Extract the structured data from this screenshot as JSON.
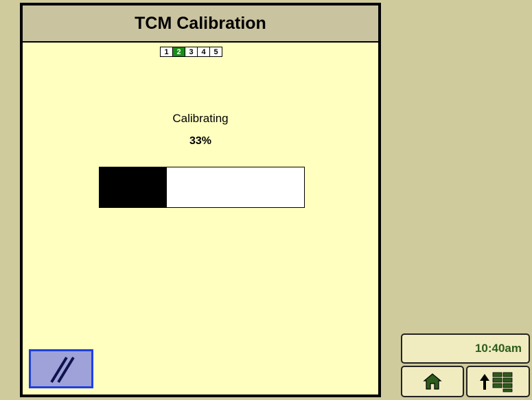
{
  "screen": {
    "title": "TCM Calibration"
  },
  "steps": [
    {
      "label": "1",
      "active": false
    },
    {
      "label": "2",
      "active": true
    },
    {
      "label": "3",
      "active": false
    },
    {
      "label": "4",
      "active": false
    },
    {
      "label": "5",
      "active": false
    }
  ],
  "calibration": {
    "status_label": "Calibrating",
    "percent_text": "33%",
    "progress_fraction": 0.33
  },
  "shortcut": {
    "icon": "slash-lines-icon"
  },
  "clock": {
    "time": "10:40am"
  },
  "nav": {
    "home_icon": "home-icon",
    "menu_icon": "menu-up-arrow-icon"
  },
  "colors": {
    "background": "#cfcb9c",
    "panel": "#ffffc0",
    "title_bar": "#c9c3a0",
    "active_step": "#1a8c1a",
    "clock_text": "#2e5c1c",
    "shortcut_border": "#1f3fe0",
    "shortcut_fill": "#9ea2d8",
    "icon_green": "#2e5c1c"
  }
}
